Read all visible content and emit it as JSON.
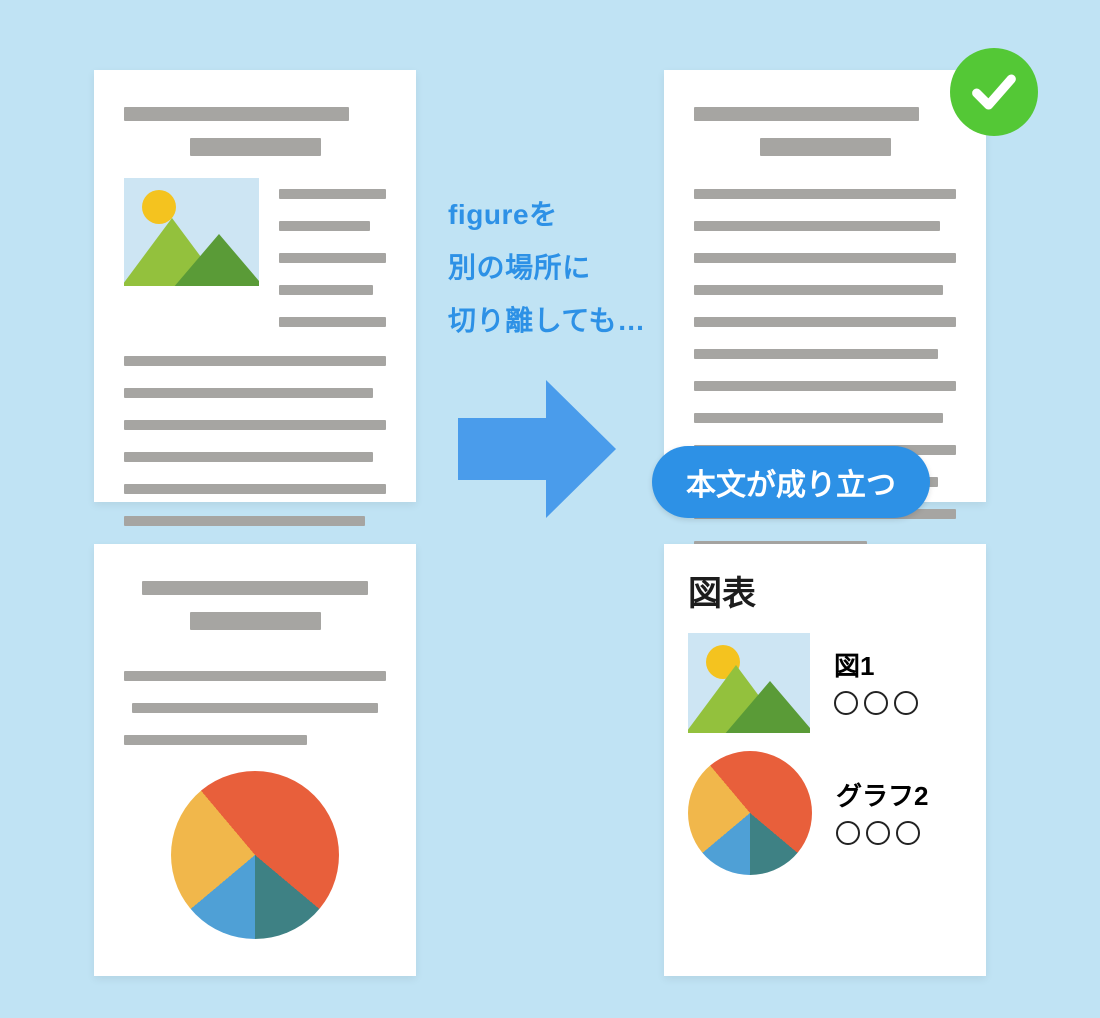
{
  "explain_text": "figureを\n別の場所に\n切り離しても…",
  "pill_label": "本文が成り立つ",
  "figures_section_heading": "図表",
  "figure_items": [
    {
      "label": "図1",
      "placeholder": "○○○"
    },
    {
      "label": "グラフ2",
      "placeholder": "○○○"
    }
  ],
  "colors": {
    "bg": "#C0E3F4",
    "accent_blue": "#2D91E6",
    "arrow_blue": "#4A9CEB",
    "check_green": "#54C836"
  },
  "chart_data": {
    "type": "pie",
    "title": "",
    "series": [
      {
        "name": "slice1-orange",
        "value": 36,
        "color": "#E85F3B"
      },
      {
        "name": "slice2-teal",
        "value": 14,
        "color": "#3E8184"
      },
      {
        "name": "slice3-blue",
        "value": 14,
        "color": "#4FA0D6"
      },
      {
        "name": "slice4-yellow",
        "value": 25,
        "color": "#F1B74B"
      },
      {
        "name": "slice5-orange2",
        "value": 11,
        "color": "#E85F3B"
      }
    ],
    "note": "Decorative pie chart with no labels or numeric axis in source image; values estimated from slice angles out of 360°."
  }
}
